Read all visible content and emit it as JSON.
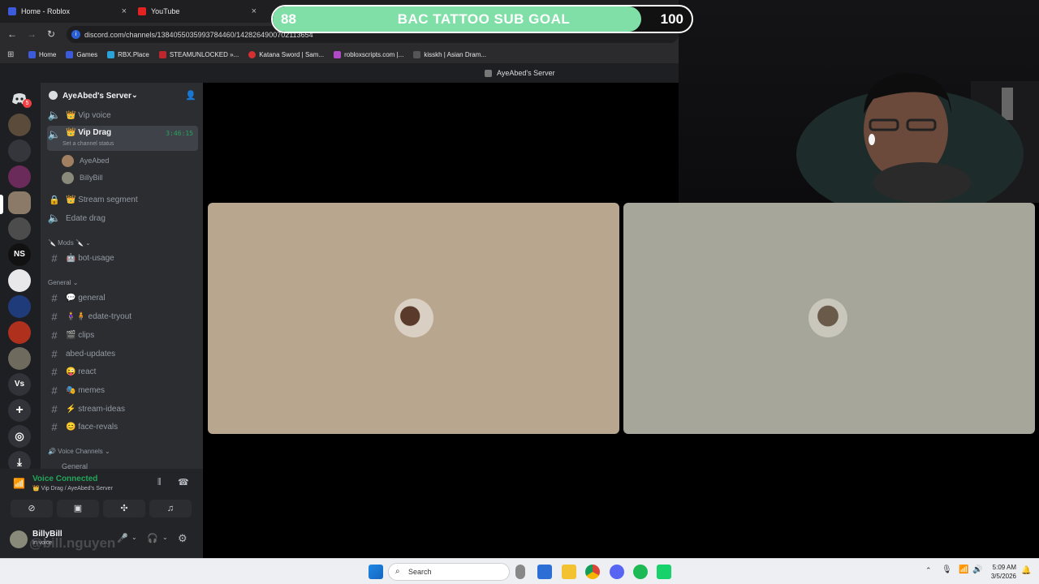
{
  "browser": {
    "tabs": [
      {
        "label": "Home - Roblox"
      },
      {
        "label": "YouTube"
      }
    ],
    "url": "discord.com/channels/1384055035993784460/1428264900702113654",
    "bookmarks": [
      "Home",
      "Games",
      "RBX.Place",
      "STEAMUNLOCKED »...",
      "Katana Sword | Sam...",
      "robloxscripts.com |...",
      "kisskh | Asian Dram..."
    ],
    "page_title": "AyeAbed's Server"
  },
  "sub_goal": {
    "title": "BAC TATTOO SUB GOAL",
    "current": "88",
    "target": "100",
    "progress_fraction": 0.88,
    "fill_color": "#7fdfa6"
  },
  "server_rail": {
    "dm_badge": "5",
    "ns_label": "NS",
    "vs_label": "Vs"
  },
  "sidebar": {
    "server_name": "AyeAbed's Server",
    "channels_top": [
      {
        "name": "👑 Vip voice"
      },
      {
        "name": "👑 Vip Drag",
        "timer": "3:46:15",
        "status": "Set a channel status"
      }
    ],
    "members": [
      "AyeAbed",
      "BillyBill"
    ],
    "channels_mid": [
      "👑 Stream segment",
      "Edate drag"
    ],
    "cat_mods": "🔪 Mods 🔪",
    "mods_channels": [
      "🤖 bot-usage"
    ],
    "cat_general": "General",
    "general_channels": [
      "💬 general",
      "🧍‍♀️🧍 edate-tryout",
      "🎬 clips",
      "abed-updates",
      "😜 react",
      "🎭 memes",
      "⚡ stream-ideas",
      "😊 face-revals"
    ],
    "cat_voice": "🔊 Voice Channels",
    "voice_peek": "General"
  },
  "voice_panel": {
    "status": "Voice Connected",
    "location": "👑 Vip Drag / AyeAbed's Server",
    "user": "BillyBill",
    "user_status": "In voice",
    "watermark": "@bill.nguyen"
  },
  "taskbar": {
    "search_placeholder": "Search",
    "time": "5:09 AM",
    "date": "3/5/2026"
  }
}
